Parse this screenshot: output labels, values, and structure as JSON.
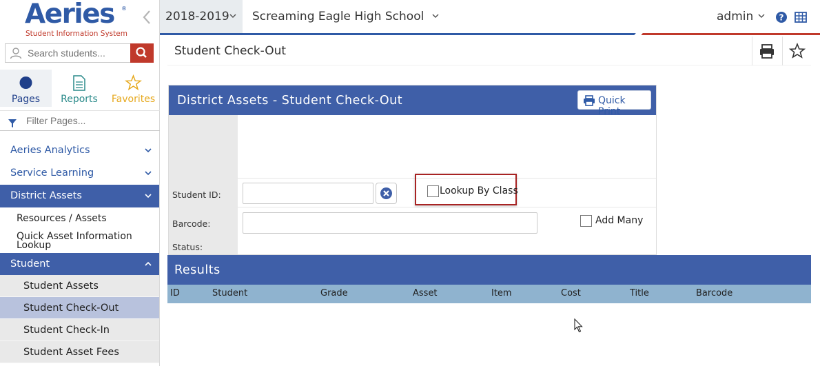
{
  "logo": {
    "title": "Aeries",
    "registered": "®",
    "subtitle": "Student Information System"
  },
  "search": {
    "placeholder": "Search students..."
  },
  "tabs": [
    {
      "label": "Pages",
      "icon": "circle-icon",
      "color": "#1f3f8a"
    },
    {
      "label": "Reports",
      "icon": "document-icon",
      "color": "#2a8a8a"
    },
    {
      "label": "Favorites",
      "icon": "star-icon",
      "color": "#e6a81c"
    }
  ],
  "filter": {
    "placeholder": "Filter Pages..."
  },
  "nav": {
    "aeries_analytics": "Aeries Analytics",
    "service_learning": "Service Learning",
    "district_assets": "District Assets",
    "resources_assets": "Resources / Assets",
    "quick_asset_line1": "Quick Asset Information",
    "quick_asset_line2": "Lookup",
    "student": "Student",
    "student_assets": "Student Assets",
    "student_checkout": "Student Check-Out",
    "student_checkin": "Student Check-In",
    "student_asset_fees": "Student Asset Fees"
  },
  "topbar": {
    "year": "2018-2019",
    "school": "Screaming Eagle High School",
    "user": "admin"
  },
  "page": {
    "title": "Student Check-Out"
  },
  "panel": {
    "title": "District Assets - Student Check-Out",
    "quick_print": "Quick Print",
    "student_id_label": "Student ID:",
    "barcode_label": "Barcode:",
    "status_label": "Status:",
    "student_id_value": "",
    "barcode_value": "",
    "lookup_by_class": "Lookup By Class",
    "add_many": "Add Many"
  },
  "results": {
    "title": "Results",
    "columns": [
      "ID",
      "Student",
      "Grade",
      "Asset",
      "Item",
      "Cost",
      "Title",
      "Barcode"
    ]
  },
  "colors": {
    "brand_blue": "#3f5fa8",
    "brand_red": "#c0392b",
    "results_header": "#8fb3cf",
    "selected_nav": "#b8c2dd"
  }
}
